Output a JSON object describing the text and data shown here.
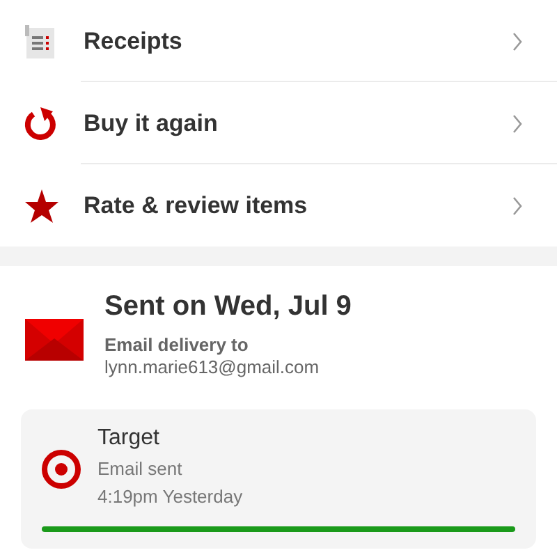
{
  "menu": [
    {
      "kind": "receipt",
      "label": "Receipts"
    },
    {
      "kind": "reorder",
      "label": "Buy it again"
    },
    {
      "kind": "star",
      "label": "Rate & review items"
    }
  ],
  "delivery": {
    "title": "Sent on Wed, Jul 9",
    "label": "Email delivery to",
    "email": "lynn.marie613@gmail.com"
  },
  "status_card": {
    "sender": "Target",
    "status": "Email sent",
    "time": "4:19pm Yesterday",
    "level": 1
  }
}
